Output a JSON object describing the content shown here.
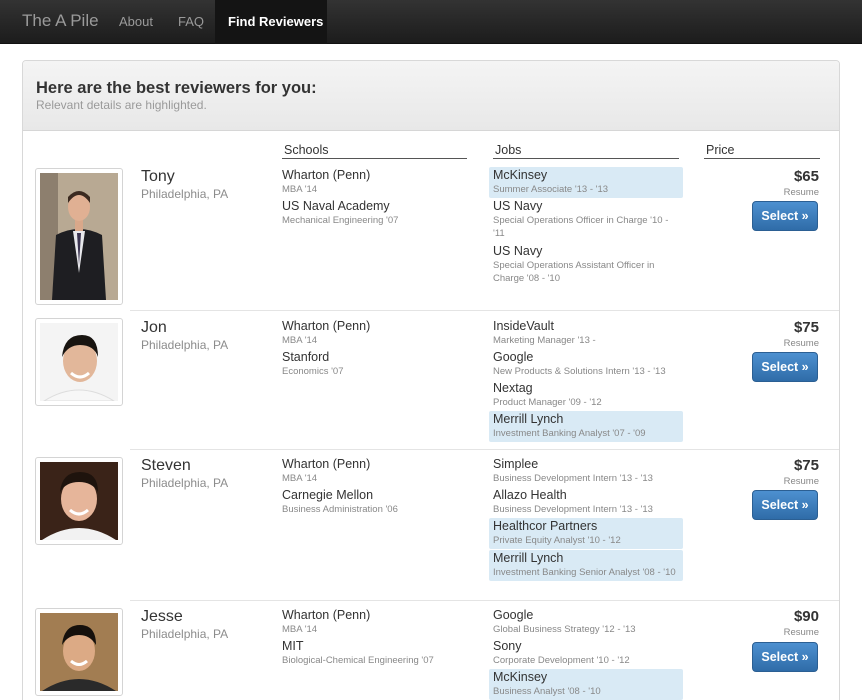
{
  "nav": {
    "brand": "The A Pile",
    "about": "About",
    "faq": "FAQ",
    "find_reviewers": "Find Reviewers"
  },
  "panel": {
    "title": "Here are the best reviewers for you:",
    "subtitle": "Relevant details are highlighted."
  },
  "columns": {
    "schools": "Schools",
    "jobs": "Jobs",
    "price": "Price"
  },
  "reviewers": [
    {
      "name": "Tony",
      "location": "Philadelphia, PA",
      "schools": [
        {
          "title": "Wharton (Penn)",
          "sub": "MBA '14"
        },
        {
          "title": "US Naval Academy",
          "sub": "Mechanical Engineering '07"
        }
      ],
      "jobs": [
        {
          "title": "McKinsey",
          "sub": "Summer Associate '13 - '13",
          "highlighted": true
        },
        {
          "title": "US Navy",
          "sub": "Special Operations Officer in Charge '10 - '11",
          "highlighted": false
        },
        {
          "title": "US Navy",
          "sub": "Special Operations Assistant Officer in Charge '08 - '10",
          "highlighted": false
        }
      ],
      "price": "$65",
      "price_type": "Resume",
      "select_label": "Select »"
    },
    {
      "name": "Jon",
      "location": "Philadelphia, PA",
      "schools": [
        {
          "title": "Wharton (Penn)",
          "sub": "MBA '14"
        },
        {
          "title": "Stanford",
          "sub": "Economics '07"
        }
      ],
      "jobs": [
        {
          "title": "InsideVault",
          "sub": "Marketing Manager '13 -",
          "highlighted": false
        },
        {
          "title": "Google",
          "sub": "New Products & Solutions Intern '13 - '13",
          "highlighted": false
        },
        {
          "title": "Nextag",
          "sub": "Product Manager '09 - '12",
          "highlighted": false
        },
        {
          "title": "Merrill Lynch",
          "sub": "Investment Banking Analyst '07 - '09",
          "highlighted": true
        }
      ],
      "price": "$75",
      "price_type": "Resume",
      "select_label": "Select »"
    },
    {
      "name": "Steven",
      "location": "Philadelphia, PA",
      "schools": [
        {
          "title": "Wharton (Penn)",
          "sub": "MBA '14"
        },
        {
          "title": "Carnegie Mellon",
          "sub": "Business Administration '06"
        }
      ],
      "jobs": [
        {
          "title": "Simplee",
          "sub": "Business Development Intern '13 - '13",
          "highlighted": false
        },
        {
          "title": "Allazo Health",
          "sub": "Business Development Intern '13 - '13",
          "highlighted": false
        },
        {
          "title": "Healthcor Partners",
          "sub": "Private Equity Analyst '10 - '12",
          "highlighted": true
        },
        {
          "title": "Merrill Lynch",
          "sub": "Investment Banking Senior Analyst '08 - '10",
          "highlighted": true
        }
      ],
      "price": "$75",
      "price_type": "Resume",
      "select_label": "Select »"
    },
    {
      "name": "Jesse",
      "location": "Philadelphia, PA",
      "schools": [
        {
          "title": "Wharton (Penn)",
          "sub": "MBA '14"
        },
        {
          "title": "MIT",
          "sub": "Biological-Chemical Engineering '07"
        }
      ],
      "jobs": [
        {
          "title": "Google",
          "sub": "Global Business Strategy '12 - '13",
          "highlighted": false
        },
        {
          "title": "Sony",
          "sub": "Corporate Development '10 - '12",
          "highlighted": false
        },
        {
          "title": "McKinsey",
          "sub": "Business Analyst '08 - '10",
          "highlighted": true
        }
      ],
      "price": "$90",
      "price_type": "Resume",
      "select_label": "Select »"
    }
  ]
}
